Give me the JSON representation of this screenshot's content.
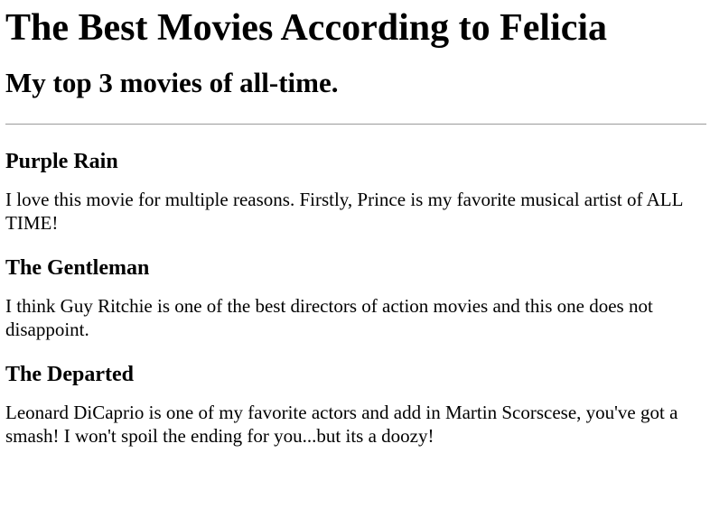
{
  "page": {
    "title": "The Best Movies According to Felicia",
    "subtitle": "My top 3 movies of all-time."
  },
  "movies": [
    {
      "title": "Purple Rain",
      "description": "I love this movie for multiple reasons. Firstly, Prince is my favorite musical artist of ALL TIME!"
    },
    {
      "title": "The Gentleman",
      "description": "I think Guy Ritchie is one of the best directors of action movies and this one does not disappoint."
    },
    {
      "title": "The Departed",
      "description": "Leonard DiCaprio is one of my favorite actors and add in Martin Scorscese, you've got a smash! I won't spoil the ending for you...but its a doozy!"
    }
  ]
}
